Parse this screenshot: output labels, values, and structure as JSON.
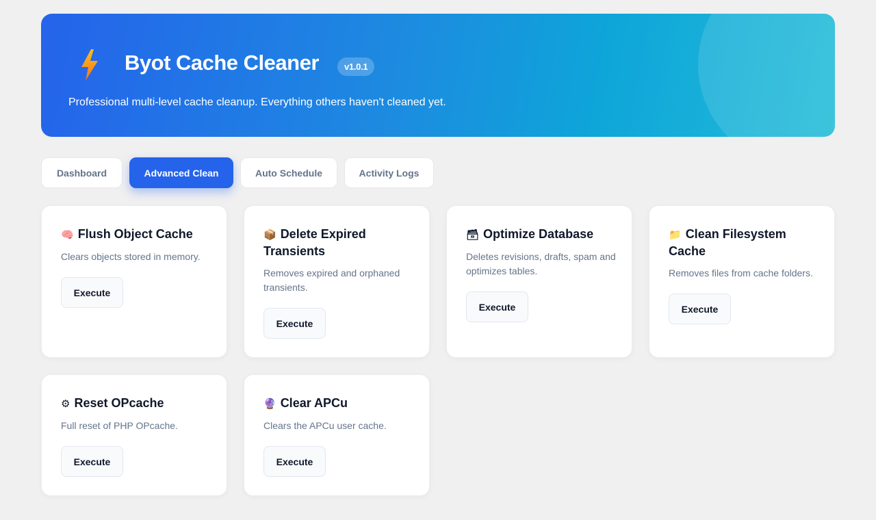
{
  "header": {
    "title": "Byot Cache Cleaner",
    "version": "v1.0.1",
    "subtitle": "Professional multi-level cache cleanup. Everything others haven't cleaned yet.",
    "icon": "lightning-bolt-icon"
  },
  "tabs": [
    {
      "label": "Dashboard",
      "active": false
    },
    {
      "label": "Advanced Clean",
      "active": true
    },
    {
      "label": "Auto Schedule",
      "active": false
    },
    {
      "label": "Activity Logs",
      "active": false
    }
  ],
  "cards": [
    {
      "icon": "brain-icon",
      "glyph": "🧠",
      "title": "Flush Object Cache",
      "description": "Clears objects stored in memory.",
      "button": "Execute"
    },
    {
      "icon": "package-icon",
      "glyph": "📦",
      "title": "Delete Expired Transients",
      "description": "Removes expired and orphaned transients.",
      "button": "Execute"
    },
    {
      "icon": "file-cabinet-icon",
      "glyph": "🗃",
      "title": "Optimize Database",
      "description": "Deletes revisions, drafts, spam and optimizes tables.",
      "button": "Execute"
    },
    {
      "icon": "folder-icon",
      "glyph": "📁",
      "title": "Clean Filesystem Cache",
      "description": "Removes files from cache folders.",
      "button": "Execute"
    },
    {
      "icon": "gear-icon",
      "glyph": "⚙",
      "title": "Reset OPcache",
      "description": "Full reset of PHP OPcache.",
      "button": "Execute"
    },
    {
      "icon": "crystal-icon",
      "glyph": "🔮",
      "title": "Clear APCu",
      "description": "Clears the APCu user cache.",
      "button": "Execute"
    }
  ],
  "colors": {
    "accent": "#2563eb",
    "hero_start": "#2563eb",
    "hero_end": "#22bcd8",
    "background": "#f0f0f1"
  }
}
